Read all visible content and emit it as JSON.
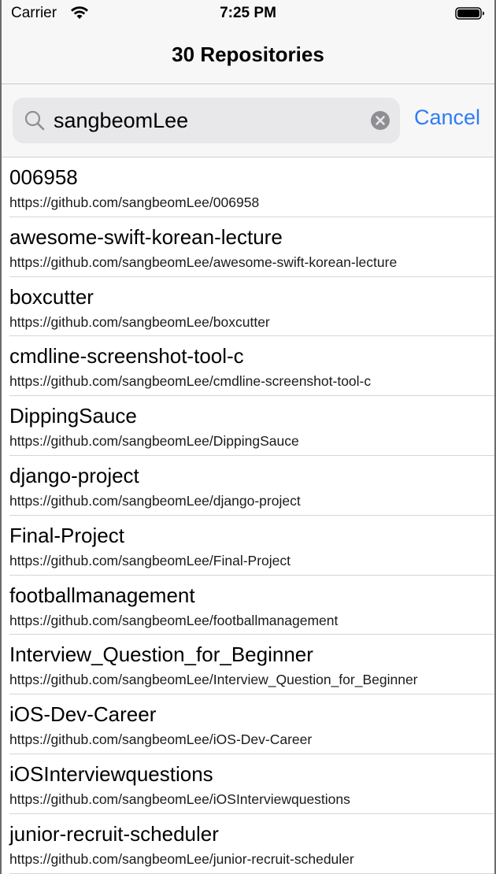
{
  "status_bar": {
    "carrier": "Carrier",
    "time": "7:25 PM"
  },
  "nav": {
    "title": "30 Repositories"
  },
  "search": {
    "value": "sangbeomLee",
    "cancel_label": "Cancel"
  },
  "colors": {
    "accent": "#2f7cf6",
    "chrome_background": "#f7f7f7",
    "search_field_background": "#e8e8ea"
  },
  "icons": {
    "search": "search-icon",
    "clear": "clear-icon",
    "wifi": "wifi-icon",
    "battery": "battery-icon"
  },
  "repositories": [
    {
      "name": "006958",
      "url": "https://github.com/sangbeomLee/006958"
    },
    {
      "name": "awesome-swift-korean-lecture",
      "url": "https://github.com/sangbeomLee/awesome-swift-korean-lecture"
    },
    {
      "name": "boxcutter",
      "url": "https://github.com/sangbeomLee/boxcutter"
    },
    {
      "name": "cmdline-screenshot-tool-c",
      "url": "https://github.com/sangbeomLee/cmdline-screenshot-tool-c"
    },
    {
      "name": "DippingSauce",
      "url": "https://github.com/sangbeomLee/DippingSauce"
    },
    {
      "name": "django-project",
      "url": "https://github.com/sangbeomLee/django-project"
    },
    {
      "name": "Final-Project",
      "url": "https://github.com/sangbeomLee/Final-Project"
    },
    {
      "name": "footballmanagement",
      "url": "https://github.com/sangbeomLee/footballmanagement"
    },
    {
      "name": "Interview_Question_for_Beginner",
      "url": "https://github.com/sangbeomLee/Interview_Question_for_Beginner"
    },
    {
      "name": "iOS-Dev-Career",
      "url": "https://github.com/sangbeomLee/iOS-Dev-Career"
    },
    {
      "name": "iOSInterviewquestions",
      "url": "https://github.com/sangbeomLee/iOSInterviewquestions"
    },
    {
      "name": "junior-recruit-scheduler",
      "url": "https://github.com/sangbeomLee/junior-recruit-scheduler"
    }
  ]
}
